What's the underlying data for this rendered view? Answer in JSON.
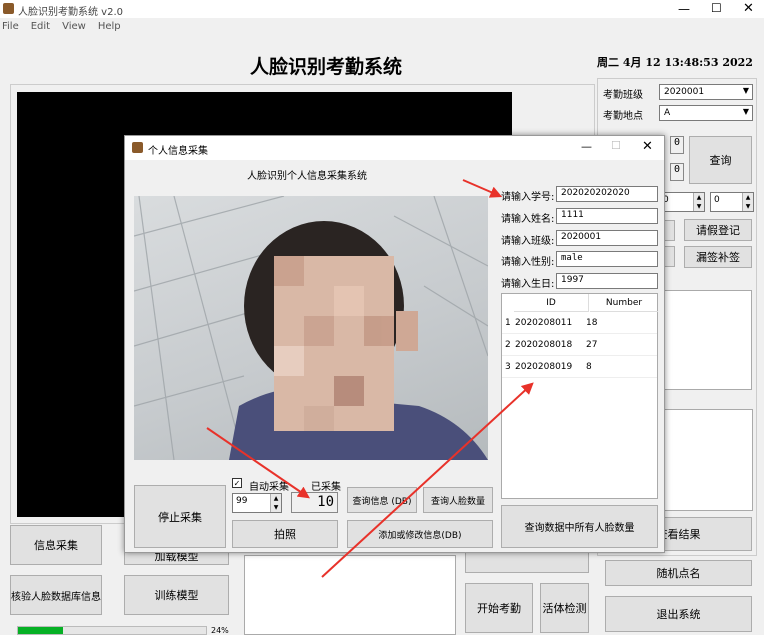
{
  "main_window": {
    "title": "人脸识别考勤系统 v2.0",
    "menu": [
      "File",
      "Edit",
      "View",
      "Help"
    ],
    "heading": "人脸识别考勤系统",
    "datetime": "周二 4月 12 13:48:53 2022",
    "class_label": "考勤班级",
    "class_value": "2020001",
    "location_label": "考勤地点",
    "location_value": "A",
    "query_button": "查询",
    "spin1": "0",
    "spin2": "0",
    "leave_button": "请假登记",
    "makeup_button": "漏签补签",
    "view_results_button": "查看结果",
    "random_call_button": "随机点名",
    "exit_button": "退出系统",
    "start_attendance_button": "开始考勤",
    "liveness_button": "活体检测",
    "info_collect_button": "信息采集",
    "load_model_button": "加载模型",
    "verify_db_button": "核验人脸数据库信息",
    "train_model_button": "训练模型",
    "progress_percent": "24%",
    "progress_value": 0.24
  },
  "dialog": {
    "title": "个人信息采集",
    "heading": "人脸识别个人信息采集系统",
    "fields": [
      {
        "label": "请输入学号:",
        "value": "202020202020"
      },
      {
        "label": "请输入姓名:",
        "value": "1111"
      },
      {
        "label": "请输入班级:",
        "value": "2020001"
      },
      {
        "label": "请输入性别:",
        "value": "male"
      },
      {
        "label": "请输入生日:",
        "value": "1997"
      }
    ],
    "table": {
      "headers": [
        "ID",
        "Number"
      ],
      "rows": [
        {
          "idx": "1",
          "id": "2020208011",
          "number": "18"
        },
        {
          "idx": "2",
          "id": "2020208018",
          "number": "27"
        },
        {
          "idx": "3",
          "id": "2020208019",
          "number": "8"
        }
      ]
    },
    "stop_collect_button": "停止采集",
    "auto_collect_label": "自动采集",
    "auto_collect_spin": "99",
    "collected_label": "已采集",
    "collected_count": "10",
    "query_info_button": "查询信息 (DB)",
    "query_face_count_button": "查询人脸数量",
    "photo_button": "拍照",
    "add_modify_button": "添加或修改信息(DB)",
    "query_all_count_button": "查询数据中所有人脸数量"
  }
}
